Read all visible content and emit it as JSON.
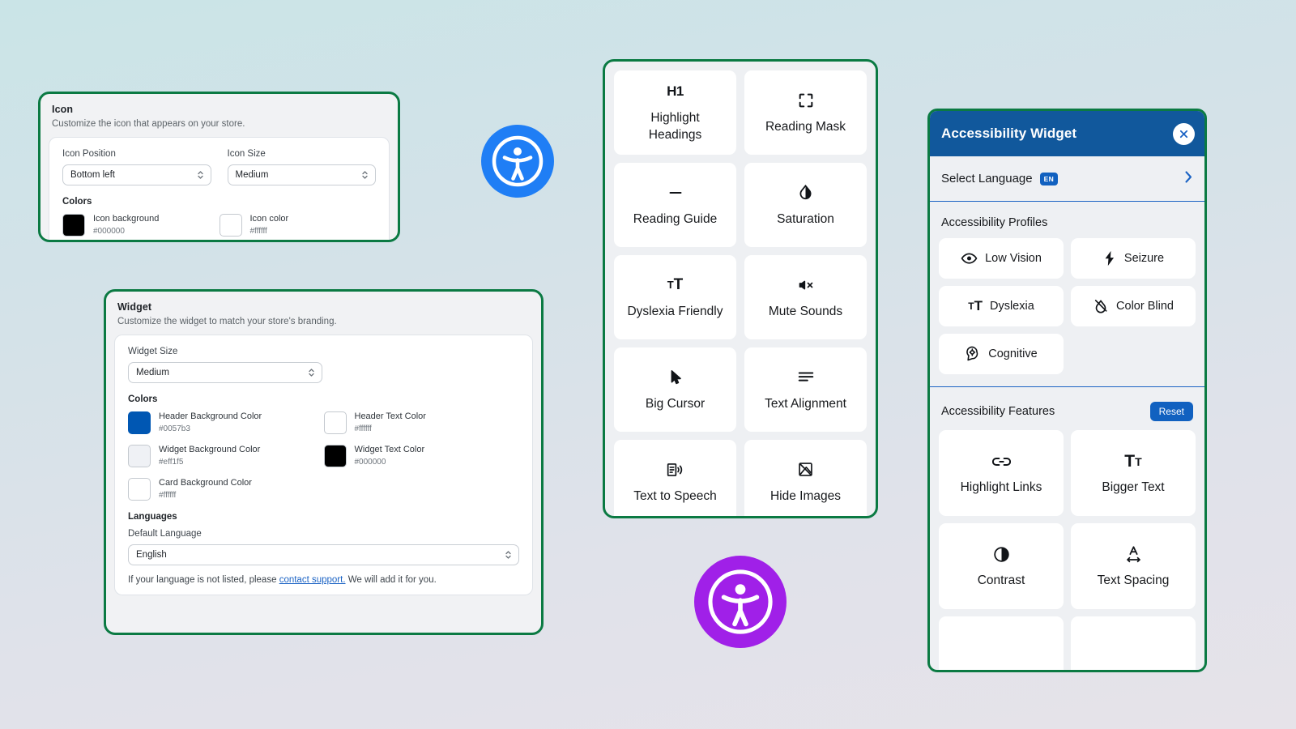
{
  "background": {
    "gradient_from": "#cae4e7",
    "gradient_to": "#e6e3e9"
  },
  "accent": {
    "green_border": "#0b7a43",
    "blue": "#1161c0",
    "header_blue": "#11589c"
  },
  "icon_panel": {
    "title": "Icon",
    "subtitle": "Customize the icon that appears on your store.",
    "fields": [
      {
        "label": "Icon Position",
        "value": "Bottom left"
      },
      {
        "label": "Icon Size",
        "value": "Medium"
      }
    ],
    "colors_heading": "Colors",
    "swatches": [
      {
        "name": "Icon background",
        "hex": "#000000"
      },
      {
        "name": "Icon color",
        "hex": "#ffffff"
      }
    ]
  },
  "widget_panel": {
    "title": "Widget",
    "subtitle": "Customize the widget to match your store's branding.",
    "size_label": "Widget Size",
    "size_value": "Medium",
    "colors_heading": "Colors",
    "swatches": [
      {
        "name": "Header Background Color",
        "hex": "#0057b3"
      },
      {
        "name": "Header Text Color",
        "hex": "#ffffff"
      },
      {
        "name": "Widget Background Color",
        "hex": "#eff1f5"
      },
      {
        "name": "Widget Text Color",
        "hex": "#000000"
      },
      {
        "name": "Card Background Color",
        "hex": "#ffffff"
      }
    ],
    "languages_heading": "Languages",
    "default_language_label": "Default Language",
    "default_language_value": "English",
    "help_prefix": "If your language is not listed, please ",
    "help_link": "contact support.",
    "help_suffix": " We will add it for you."
  },
  "feature_panel": {
    "cards": [
      {
        "icon": "h1-icon",
        "label": "Highlight Headings"
      },
      {
        "icon": "reading-mask-icon",
        "label": "Reading Mask"
      },
      {
        "icon": "reading-guide-icon",
        "label": "Reading Guide"
      },
      {
        "icon": "saturation-icon",
        "label": "Saturation"
      },
      {
        "icon": "dyslexia-icon",
        "label": "Dyslexia Friendly"
      },
      {
        "icon": "mute-sounds-icon",
        "label": "Mute Sounds"
      },
      {
        "icon": "big-cursor-icon",
        "label": "Big Cursor"
      },
      {
        "icon": "text-alignment-icon",
        "label": "Text Alignment"
      },
      {
        "icon": "text-to-speech-icon",
        "label": "Text to Speech"
      },
      {
        "icon": "hide-images-icon",
        "label": "Hide Images"
      }
    ]
  },
  "accessibility_widget": {
    "title": "Accessibility Widget",
    "close_label": "×",
    "language": {
      "label": "Select Language",
      "badge": "EN"
    },
    "profiles_heading": "Accessibility Profiles",
    "profiles": [
      {
        "icon": "eye-icon",
        "label": "Low Vision"
      },
      {
        "icon": "bolt-icon",
        "label": "Seizure"
      },
      {
        "icon": "dyslexia-icon",
        "label": "Dyslexia"
      },
      {
        "icon": "eye-off-icon",
        "label": "Color Blind"
      },
      {
        "icon": "brain-icon",
        "label": "Cognitive"
      }
    ],
    "features_heading": "Accessibility Features",
    "reset_label": "Reset",
    "features": [
      {
        "icon": "link-icon",
        "label": "Highlight Links"
      },
      {
        "icon": "bigger-text-icon",
        "label": "Bigger Text"
      },
      {
        "icon": "contrast-icon",
        "label": "Contrast"
      },
      {
        "icon": "text-spacing-icon",
        "label": "Text Spacing"
      }
    ]
  },
  "badges": [
    {
      "name": "accessibility-badge-blue",
      "color": "#1f7ef5"
    },
    {
      "name": "accessibility-badge-purple",
      "color": "#a020e8"
    }
  ]
}
